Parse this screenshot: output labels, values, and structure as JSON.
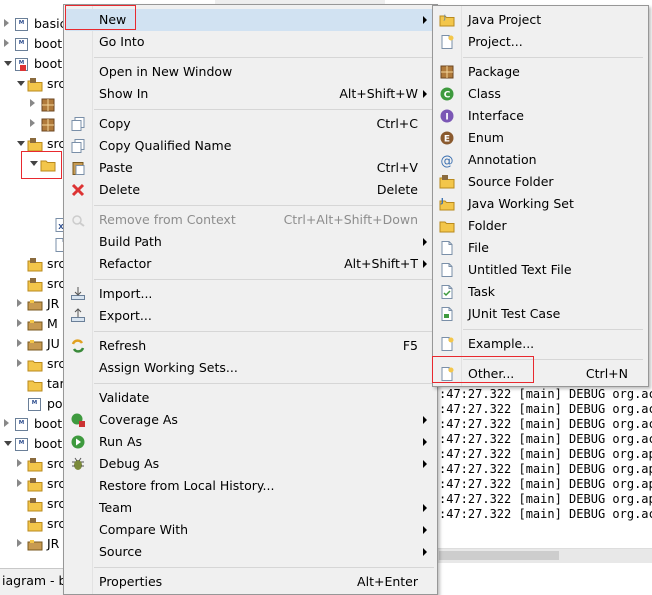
{
  "tree": {
    "rows": [
      {
        "label": "basic",
        "icon": "maven-project-icon",
        "depth": 0,
        "twisty": "closed"
      },
      {
        "label": "boot",
        "icon": "maven-project-icon",
        "depth": 0,
        "twisty": "closed"
      },
      {
        "label": "boot",
        "icon": "maven-project-error-icon",
        "depth": 0,
        "twisty": "open"
      },
      {
        "label": "src",
        "icon": "source-folder-icon",
        "depth": 1,
        "twisty": "open"
      },
      {
        "label": "",
        "icon": "package-icon",
        "depth": 2,
        "twisty": "closed"
      },
      {
        "label": "",
        "icon": "package-icon",
        "depth": 2,
        "twisty": "closed"
      },
      {
        "label": "src",
        "icon": "source-folder-icon",
        "depth": 1,
        "twisty": "open"
      },
      {
        "label": "",
        "icon": "folder-open-icon",
        "depth": 2,
        "twisty": "open"
      },
      {
        "label": "",
        "icon": "",
        "depth": 3,
        "twisty": "none"
      },
      {
        "label": "",
        "icon": "",
        "depth": 3,
        "twisty": "none"
      },
      {
        "label": "",
        "icon": "xml-file-icon",
        "depth": 3,
        "twisty": "none"
      },
      {
        "label": "",
        "icon": "file-icon",
        "depth": 3,
        "twisty": "none"
      },
      {
        "label": "src",
        "icon": "source-folder-icon",
        "depth": 1,
        "twisty": "none"
      },
      {
        "label": "src",
        "icon": "source-folder-icon",
        "depth": 1,
        "twisty": "none"
      },
      {
        "label": "JR",
        "icon": "library-icon",
        "depth": 1,
        "twisty": "closed"
      },
      {
        "label": "M",
        "icon": "library-icon",
        "depth": 1,
        "twisty": "closed"
      },
      {
        "label": "JU",
        "icon": "library-icon",
        "depth": 1,
        "twisty": "closed"
      },
      {
        "label": "src",
        "icon": "folder-icon",
        "depth": 1,
        "twisty": "closed"
      },
      {
        "label": "tar",
        "icon": "folder-icon",
        "depth": 1,
        "twisty": "none"
      },
      {
        "label": "po",
        "icon": "maven-pom-icon",
        "depth": 1,
        "twisty": "none"
      },
      {
        "label": "boot",
        "icon": "maven-project-icon",
        "depth": 0,
        "twisty": "closed"
      },
      {
        "label": "boot",
        "icon": "maven-project-icon",
        "depth": 0,
        "twisty": "open"
      },
      {
        "label": "src",
        "icon": "source-folder-icon",
        "depth": 1,
        "twisty": "closed"
      },
      {
        "label": "src",
        "icon": "source-folder-icon",
        "depth": 1,
        "twisty": "closed"
      },
      {
        "label": "src",
        "icon": "source-folder-icon",
        "depth": 1,
        "twisty": "none"
      },
      {
        "label": "src",
        "icon": "source-folder-icon",
        "depth": 1,
        "twisty": "none"
      },
      {
        "label": "JR",
        "icon": "library-icon",
        "depth": 1,
        "twisty": "closed"
      }
    ]
  },
  "status_tab": "iagram - b",
  "console": {
    "lines": [
      ":47:27.322 [main] DEBUG org.act",
      ":47:27.322 [main] DEBUG org.act",
      ":47:27.322 [main] DEBUG org.act",
      ":47:27.322 [main] DEBUG org.act",
      ":47:27.322 [main] DEBUG org.apa",
      ":47:27.322 [main] DEBUG org.apa",
      ":47:27.322 [main] DEBUG org.apa",
      ":47:27.322 [main] DEBUG org.apa",
      ":47:27.322 [main] DEBUG org.act"
    ]
  },
  "context_menu": {
    "items": [
      {
        "label": "New",
        "shortcut": "",
        "submenu": true,
        "icon": "",
        "disabled": false,
        "highlighted": true
      },
      {
        "label": "Go Into",
        "shortcut": "",
        "submenu": false,
        "icon": "",
        "disabled": false
      },
      {
        "separator": true
      },
      {
        "label": "Open in New Window",
        "shortcut": "",
        "submenu": false,
        "icon": "",
        "disabled": false
      },
      {
        "label": "Show In",
        "shortcut": "Alt+Shift+W",
        "submenu": true,
        "icon": "",
        "disabled": false
      },
      {
        "separator": true
      },
      {
        "label": "Copy",
        "shortcut": "Ctrl+C",
        "submenu": false,
        "icon": "copy-icon",
        "disabled": false
      },
      {
        "label": "Copy Qualified Name",
        "shortcut": "",
        "submenu": false,
        "icon": "copy-qualified-name-icon",
        "disabled": false
      },
      {
        "label": "Paste",
        "shortcut": "Ctrl+V",
        "submenu": false,
        "icon": "paste-icon",
        "disabled": false
      },
      {
        "label": "Delete",
        "shortcut": "Delete",
        "submenu": false,
        "icon": "delete-icon",
        "disabled": false
      },
      {
        "separator": true
      },
      {
        "label": "Remove from Context",
        "shortcut": "Ctrl+Alt+Shift+Down",
        "submenu": false,
        "icon": "remove-context-icon",
        "disabled": true
      },
      {
        "label": "Build Path",
        "shortcut": "",
        "submenu": true,
        "icon": "",
        "disabled": false
      },
      {
        "label": "Refactor",
        "shortcut": "Alt+Shift+T",
        "submenu": true,
        "icon": "",
        "disabled": false
      },
      {
        "separator": true
      },
      {
        "label": "Import...",
        "shortcut": "",
        "submenu": false,
        "icon": "import-icon",
        "disabled": false
      },
      {
        "label": "Export...",
        "shortcut": "",
        "submenu": false,
        "icon": "export-icon",
        "disabled": false
      },
      {
        "separator": true
      },
      {
        "label": "Refresh",
        "shortcut": "F5",
        "submenu": false,
        "icon": "refresh-icon",
        "disabled": false
      },
      {
        "label": "Assign Working Sets...",
        "shortcut": "",
        "submenu": false,
        "icon": "",
        "disabled": false
      },
      {
        "separator": true
      },
      {
        "label": "Validate",
        "shortcut": "",
        "submenu": false,
        "icon": "",
        "disabled": false
      },
      {
        "label": "Coverage As",
        "shortcut": "",
        "submenu": true,
        "icon": "coverage-icon",
        "disabled": false
      },
      {
        "label": "Run As",
        "shortcut": "",
        "submenu": true,
        "icon": "run-icon",
        "disabled": false
      },
      {
        "label": "Debug As",
        "shortcut": "",
        "submenu": true,
        "icon": "debug-icon",
        "disabled": false
      },
      {
        "label": "Restore from Local History...",
        "shortcut": "",
        "submenu": false,
        "icon": "",
        "disabled": false
      },
      {
        "label": "Team",
        "shortcut": "",
        "submenu": true,
        "icon": "",
        "disabled": false
      },
      {
        "label": "Compare With",
        "shortcut": "",
        "submenu": true,
        "icon": "",
        "disabled": false
      },
      {
        "label": "Source",
        "shortcut": "",
        "submenu": true,
        "icon": "",
        "disabled": false
      },
      {
        "separator": true
      },
      {
        "label": "Properties",
        "shortcut": "Alt+Enter",
        "submenu": false,
        "icon": "",
        "disabled": false
      }
    ]
  },
  "new_submenu": {
    "items": [
      {
        "label": "Java Project",
        "shortcut": "",
        "icon": "java-project-icon"
      },
      {
        "label": "Project...",
        "shortcut": "",
        "icon": "project-icon"
      },
      {
        "separator": true
      },
      {
        "label": "Package",
        "shortcut": "",
        "icon": "package-icon"
      },
      {
        "label": "Class",
        "shortcut": "",
        "icon": "class-icon"
      },
      {
        "label": "Interface",
        "shortcut": "",
        "icon": "interface-icon"
      },
      {
        "label": "Enum",
        "shortcut": "",
        "icon": "enum-icon"
      },
      {
        "label": "Annotation",
        "shortcut": "",
        "icon": "annotation-icon"
      },
      {
        "label": "Source Folder",
        "shortcut": "",
        "icon": "source-folder-icon"
      },
      {
        "label": "Java Working Set",
        "shortcut": "",
        "icon": "java-working-set-icon"
      },
      {
        "label": "Folder",
        "shortcut": "",
        "icon": "folder-icon"
      },
      {
        "label": "File",
        "shortcut": "",
        "icon": "file-icon"
      },
      {
        "label": "Untitled Text File",
        "shortcut": "",
        "icon": "untitled-text-file-icon"
      },
      {
        "label": "Task",
        "shortcut": "",
        "icon": "task-icon"
      },
      {
        "label": "JUnit Test Case",
        "shortcut": "",
        "icon": "junit-test-case-icon"
      },
      {
        "separator": true
      },
      {
        "label": "Example...",
        "shortcut": "",
        "icon": "example-icon"
      },
      {
        "separator": true
      },
      {
        "label": "Other...",
        "shortcut": "Ctrl+N",
        "icon": "other-wizard-icon"
      }
    ]
  },
  "colors": {
    "highlight": "#d1e2f2",
    "annotation_red": "#e8292f",
    "menu_bg": "#f0f0f0",
    "disabled_text": "#8d8d8d"
  }
}
